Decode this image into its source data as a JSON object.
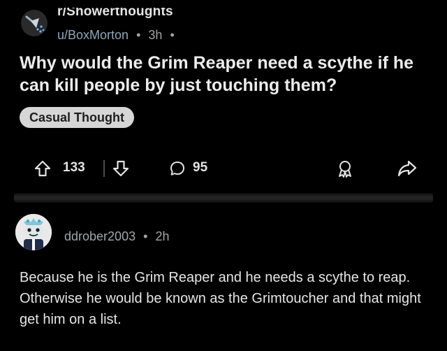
{
  "post": {
    "subreddit": "r/Showerthoughts",
    "author": "u/BoxMorton",
    "time": "3h",
    "separator": "•",
    "trailing_separator": "•",
    "title": "Why would the Grim Reaper need a scythe if he can kill people by just touching them?",
    "flair": "Casual Thought",
    "flair_color": "#d6d6d6"
  },
  "actions": {
    "upvotes": "133",
    "comments": "95"
  },
  "comment": {
    "author": "ddrober2003",
    "separator": "•",
    "time": "2h",
    "body": "Because he is the Grim Reaper and he needs a scythe to reap. Otherwise he would be known as the Grimtoucher and that might get him on a list."
  },
  "icons": {
    "upvote": "arrow-up-outline-icon",
    "downvote": "arrow-down-outline-icon",
    "comment": "speech-bubble-icon",
    "award": "award-ribbon-icon",
    "share": "share-arrow-icon"
  },
  "colors": {
    "background": "#000000",
    "author_link": "#8ca7b7",
    "muted_text": "#9ea0a3"
  }
}
